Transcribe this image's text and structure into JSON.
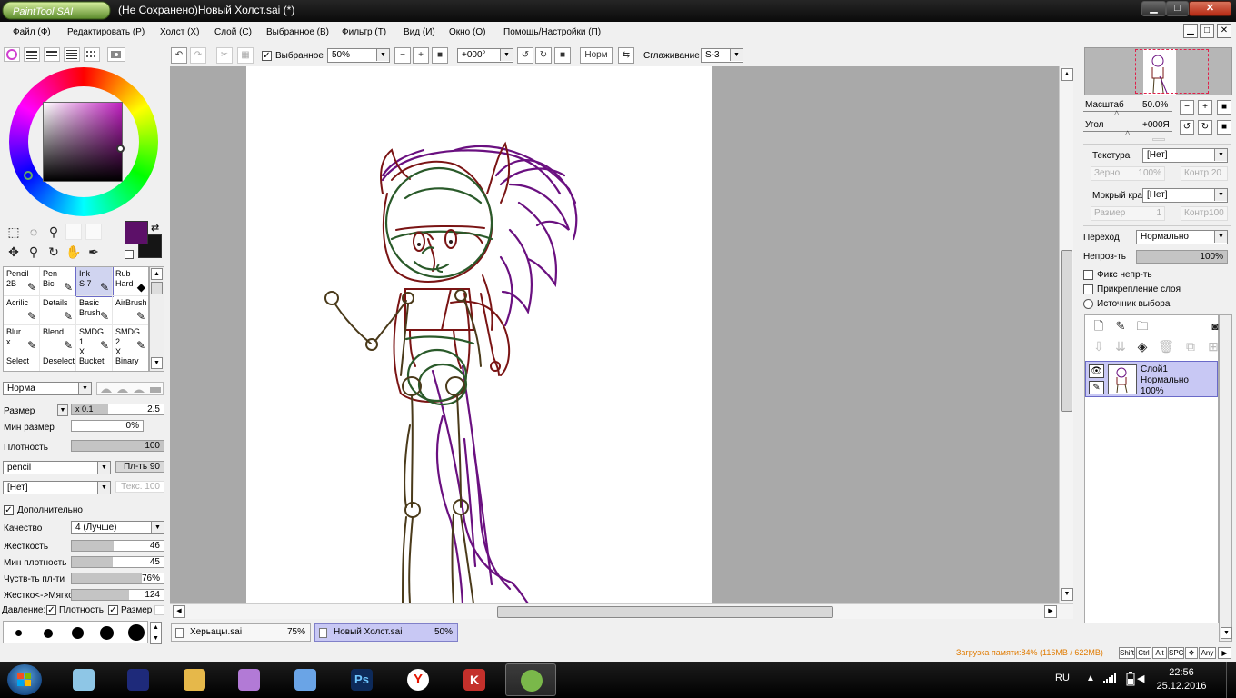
{
  "window": {
    "title": "(Не Сохранено)Новый Холст.sai (*)",
    "logo_text": "PaintTool SAI",
    "min_glyph": "▁",
    "max_glyph": "□",
    "close_glyph": "✕"
  },
  "menu": {
    "items": [
      "Файл (Ф)",
      "Редактировать (Р)",
      "Холст (Х)",
      "Слой (С)",
      "Выбранное (В)",
      "Фильтр (Т)",
      "Вид (И)",
      "Окно (О)",
      "Помощь/Настройки (П)"
    ],
    "mdi": [
      "▁",
      "□",
      "✕"
    ]
  },
  "color_panel": {
    "primary_color": "#5c1068",
    "secondary_color": "#151515"
  },
  "tools": [
    "selection-rect-icon",
    "lasso-icon",
    "magic-wand-icon",
    "move-icon",
    "zoom-icon",
    "rotate-icon",
    "hand-icon",
    "eyedropper-icon"
  ],
  "brushes": [
    {
      "line1": "Pencil",
      "line2": "2B",
      "icon": "✎"
    },
    {
      "line1": "Pen",
      "line2": "Bic",
      "icon": "✎"
    },
    {
      "line1": "Ink",
      "line2": "S 7",
      "icon": "✎",
      "selected": true
    },
    {
      "line1": "Rub",
      "line2": "Hard",
      "icon": "◆"
    },
    {
      "line1": "Acrilic",
      "line2": "",
      "icon": "✎"
    },
    {
      "line1": "Details",
      "line2": "",
      "icon": "✎"
    },
    {
      "line1": "Basic",
      "line2": "Brush",
      "icon": "✎"
    },
    {
      "line1": "AirBrush",
      "line2": "",
      "icon": "✎"
    },
    {
      "line1": "Blur",
      "line2": "x",
      "icon": "✎"
    },
    {
      "line1": "Blend",
      "line2": "",
      "icon": "✎"
    },
    {
      "line1": "SMDG 1",
      "line2": "X",
      "icon": "✎"
    },
    {
      "line1": "SMDG 2",
      "line2": "X",
      "icon": "✎"
    },
    {
      "line1": "Select",
      "line2": "",
      "icon": ""
    },
    {
      "line1": "Deselect",
      "line2": "",
      "icon": ""
    },
    {
      "line1": "Bucket",
      "line2": "",
      "icon": ""
    },
    {
      "line1": "Binary",
      "line2": "",
      "icon": ""
    }
  ],
  "brush_settings": {
    "blend_mode": "Норма",
    "size_label": "Размер",
    "size_multiplier": "x 0.1",
    "size_value": "2.5",
    "min_size_label": "Мин размер",
    "min_size_value": "0%",
    "density_label": "Плотность",
    "density_value": "100",
    "shape": "pencil",
    "shape_strength": "Пл-ть 90",
    "texture": "[Нет]",
    "texture_strength": "Текс. 100",
    "advanced_label": "Дополнительно",
    "quality_label": "Качество",
    "quality_value": "4 (Лучше)",
    "hardness_label": "Жесткость",
    "hardness_value": "46",
    "min_density_label": "Мин плотность",
    "min_density_value": "45",
    "pressure_sens_label": "Чуств-ть пл-ти",
    "pressure_sens_value": "76%",
    "hard_soft_label": "Жестко<->Мягко",
    "hard_soft_value": "124",
    "pressure_label": "Давление:",
    "pressure_density": "Плотность",
    "pressure_size": "Размер"
  },
  "toolbar": {
    "selection_label": "Выбранное",
    "zoom": "50%",
    "angle": "+000°",
    "norm_label": "Норм",
    "smoothing_label": "Сглаживание",
    "smoothing_value": "S-3"
  },
  "doc_tabs": [
    {
      "name": "Херьацы.sai",
      "zoom": "75%"
    },
    {
      "name": "Новый Холст.sai",
      "zoom": "50%",
      "active": true
    }
  ],
  "navigator": {
    "scale_label": "Масштаб",
    "scale_value": "50.0%",
    "angle_label": "Угол",
    "angle_value": "+000Я"
  },
  "layer_props": {
    "texture_label": "Текстура",
    "texture_value": "[Нет]",
    "grain_label": "Зерно",
    "grain_value": "100%",
    "contrast_label": "Контр 20",
    "wet_edge_label": "Мокрый край",
    "wet_edge_value": "[Нет]",
    "size_label": "Размер",
    "size_value": "1",
    "contrast2_label": "Контр100",
    "blend_label": "Переход",
    "blend_value": "Нормально",
    "opacity_label": "Непроз-ть",
    "opacity_value": "100%",
    "preserve_opacity": "Фикс непр-ть",
    "clipping": "Прикрепление слоя",
    "selection_source": "Источник выбора"
  },
  "layers": [
    {
      "name": "Слой1",
      "mode": "Нормально",
      "opacity": "100%"
    }
  ],
  "status": {
    "memory": "Загрузка памяти:84% (116MB / 622MB)",
    "keys": [
      "Shift",
      "Ctrl",
      "Alt",
      "SPC",
      "✥",
      "Any",
      "▶"
    ]
  },
  "taskbar": {
    "language": "RU",
    "time": "22:56",
    "date": "25.12.2016",
    "apps": [
      {
        "icon": "pony-icon",
        "color": "#8ec6e6"
      },
      {
        "icon": "pony-dark-icon",
        "color": "#1e2a7a"
      },
      {
        "icon": "file-explorer-icon",
        "color": "#e6b84a"
      },
      {
        "icon": "pony-purple-icon",
        "color": "#b27ad6"
      },
      {
        "icon": "pony-blue-icon",
        "color": "#6aa4e6"
      },
      {
        "icon": "photoshop-icon",
        "color": "#0d2a5a"
      },
      {
        "icon": "yandex-browser-icon",
        "color": "#ffffff"
      },
      {
        "icon": "kaspersky-icon",
        "color": "#c4302b"
      },
      {
        "icon": "painttool-sai-icon",
        "color": "#7ab84a",
        "active": true
      }
    ]
  }
}
